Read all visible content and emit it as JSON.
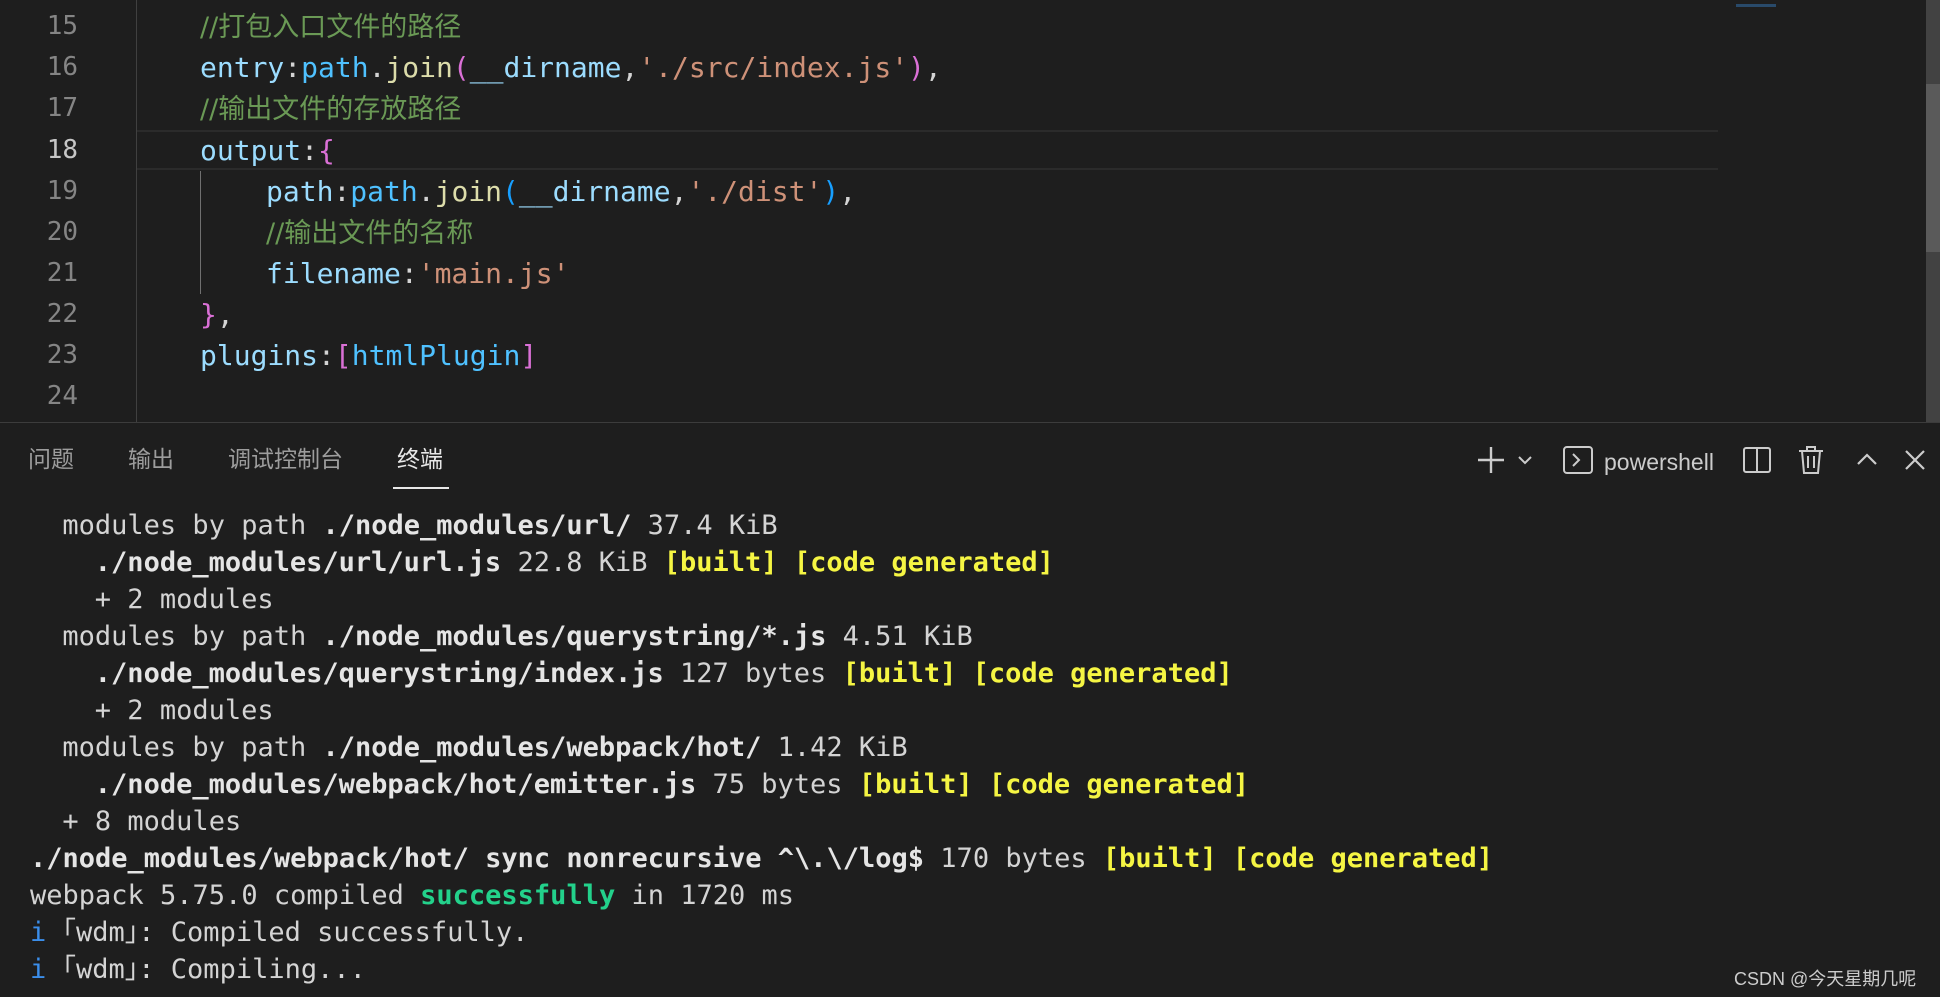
{
  "editor": {
    "line_numbers": [
      "15",
      "16",
      "17",
      "18",
      "19",
      "20",
      "21",
      "22",
      "23",
      "24"
    ],
    "active_line": "18",
    "lines": [
      {
        "comment": "//打包入口文件的路径"
      },
      {
        "key": "entry",
        "colon": ":",
        "obj": "path",
        "dot": ".",
        "fn": "join",
        "open": "(",
        "arg1": "__dirname",
        "comma": ",",
        "str": "'./src/index.js'",
        "close": ")",
        "tail": ","
      },
      {
        "comment": "//输出文件的存放路径"
      },
      {
        "key": "output",
        "colon": ":",
        "brace": "{"
      },
      {
        "key": "path",
        "colon": ":",
        "obj": "path",
        "dot": ".",
        "fn": "join",
        "open": "(",
        "arg1": "__dirname",
        "comma": ",",
        "str": "'./dist'",
        "close": ")",
        "tail": ","
      },
      {
        "comment": "//输出文件的名称"
      },
      {
        "key": "filename",
        "colon": ":",
        "str": "'main.js'"
      },
      {
        "brace": "}",
        "tail": ","
      },
      {
        "key": "plugins",
        "colon": ":",
        "open": "[",
        "ident": "htmlPlugin",
        "close": "]"
      }
    ]
  },
  "panel": {
    "tabs": [
      {
        "label": "问题"
      },
      {
        "label": "输出"
      },
      {
        "label": "调试控制台"
      },
      {
        "label": "终端"
      }
    ],
    "active_tab": "终端",
    "shell_name": "powershell",
    "icons": {
      "new": "plus-icon",
      "dropdown": "chevron-down-icon",
      "shell": "terminal-icon",
      "split": "split-icon",
      "kill": "trash-icon",
      "maximize": "chevron-up-icon",
      "close": "close-icon"
    }
  },
  "terminal": {
    "lines": [
      {
        "indent": 2,
        "parts": [
          {
            "t": "modules by path ",
            "s": "n"
          },
          {
            "t": "./node_modules/url/",
            "s": "b"
          },
          {
            "t": " 37.4 KiB",
            "s": "n"
          }
        ]
      },
      {
        "indent": 4,
        "parts": [
          {
            "t": "./node_modules/url/url.js",
            "s": "b"
          },
          {
            "t": " 22.8 KiB ",
            "s": "n"
          },
          {
            "t": "[built]",
            "s": "y"
          },
          {
            "t": " ",
            "s": "n"
          },
          {
            "t": "[code generated]",
            "s": "y"
          }
        ]
      },
      {
        "indent": 4,
        "parts": [
          {
            "t": "+ 2 modules",
            "s": "n"
          }
        ]
      },
      {
        "indent": 2,
        "parts": [
          {
            "t": "modules by path ",
            "s": "n"
          },
          {
            "t": "./node_modules/querystring/*.js",
            "s": "b"
          },
          {
            "t": " 4.51 KiB",
            "s": "n"
          }
        ]
      },
      {
        "indent": 4,
        "parts": [
          {
            "t": "./node_modules/querystring/index.js",
            "s": "b"
          },
          {
            "t": " 127 bytes ",
            "s": "n"
          },
          {
            "t": "[built]",
            "s": "y"
          },
          {
            "t": " ",
            "s": "n"
          },
          {
            "t": "[code generated]",
            "s": "y"
          }
        ]
      },
      {
        "indent": 4,
        "parts": [
          {
            "t": "+ 2 modules",
            "s": "n"
          }
        ]
      },
      {
        "indent": 2,
        "parts": [
          {
            "t": "modules by path ",
            "s": "n"
          },
          {
            "t": "./node_modules/webpack/hot/",
            "s": "b"
          },
          {
            "t": " 1.42 KiB",
            "s": "n"
          }
        ]
      },
      {
        "indent": 4,
        "parts": [
          {
            "t": "./node_modules/webpack/hot/emitter.js",
            "s": "b"
          },
          {
            "t": " 75 bytes ",
            "s": "n"
          },
          {
            "t": "[built]",
            "s": "y"
          },
          {
            "t": " ",
            "s": "n"
          },
          {
            "t": "[code generated]",
            "s": "y"
          }
        ]
      },
      {
        "indent": 2,
        "parts": [
          {
            "t": "+ 8 modules",
            "s": "n"
          }
        ]
      },
      {
        "indent": 0,
        "parts": [
          {
            "t": "./node_modules/webpack/hot/ sync nonrecursive ^\\.\\/log$",
            "s": "b"
          },
          {
            "t": " 170 bytes ",
            "s": "n"
          },
          {
            "t": "[built]",
            "s": "y"
          },
          {
            "t": " ",
            "s": "n"
          },
          {
            "t": "[code generated]",
            "s": "y"
          }
        ]
      },
      {
        "indent": 0,
        "parts": [
          {
            "t": "webpack 5.75.0 compiled ",
            "s": "n"
          },
          {
            "t": "successfully",
            "s": "g"
          },
          {
            "t": " in 1720 ms",
            "s": "n"
          }
        ]
      },
      {
        "indent": 0,
        "parts": [
          {
            "t": "i",
            "s": "i"
          },
          {
            "t": " ｢wdm｣: Compiled successfully.",
            "s": "n"
          }
        ]
      },
      {
        "indent": 0,
        "parts": [
          {
            "t": "i",
            "s": "i"
          },
          {
            "t": " ｢wdm｣: Compiling...",
            "s": "n"
          }
        ]
      }
    ]
  },
  "watermark": "CSDN @今天星期几呢"
}
